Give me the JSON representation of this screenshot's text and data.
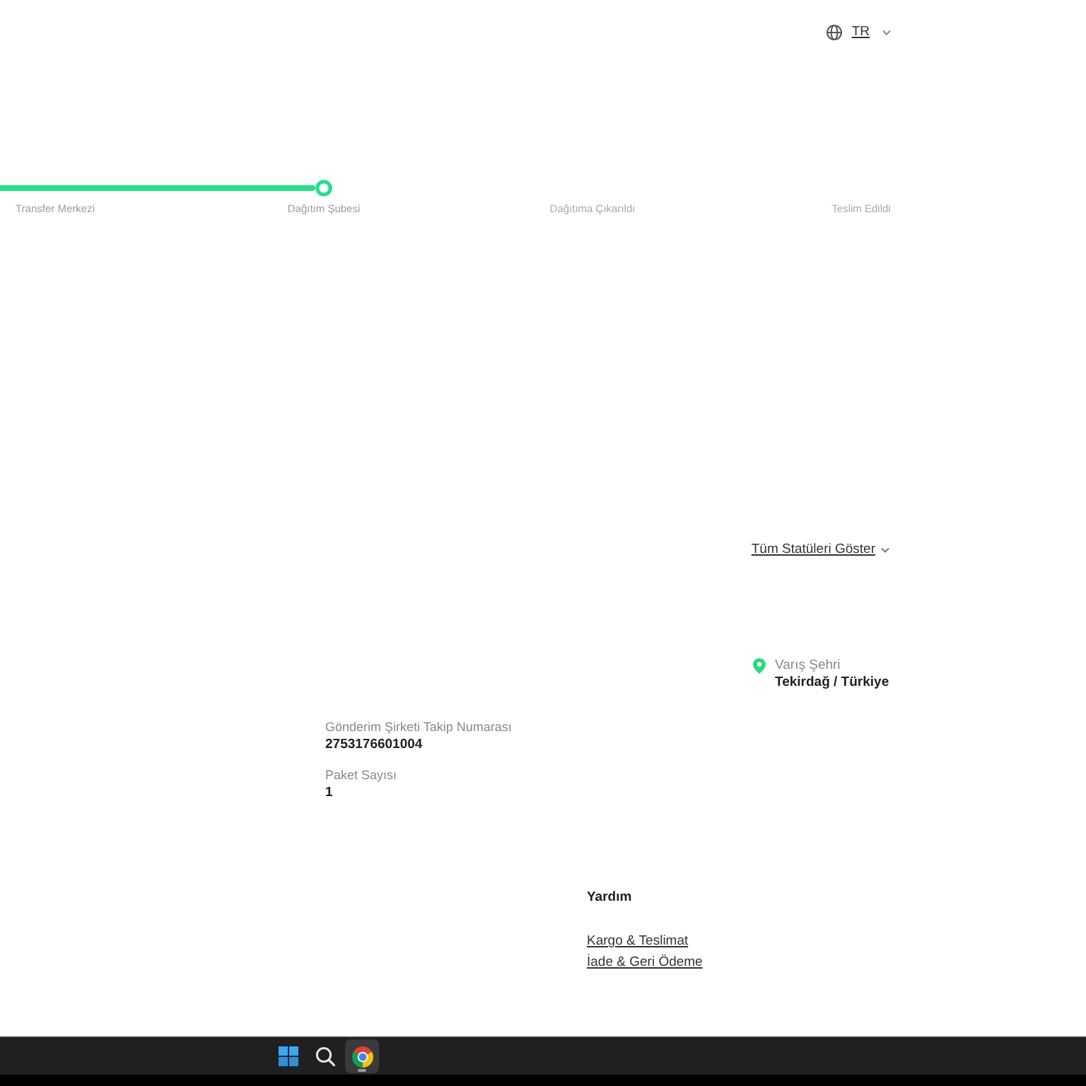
{
  "language_selector": {
    "code": "TR"
  },
  "progress_steps": [
    {
      "label": "Transfer Merkezi",
      "reached": true,
      "current": false
    },
    {
      "label": "Dağıtım Şubesi",
      "reached": true,
      "current": true
    },
    {
      "label": "Dağıtıma Çıkarıldı",
      "reached": false,
      "current": false
    },
    {
      "label": "Teslim Edildi",
      "reached": false,
      "current": false
    }
  ],
  "show_all_statuses": {
    "label": "Tüm Statüleri Göster"
  },
  "destination": {
    "label": "Varış Şehri",
    "value": "Tekirdağ / Türkiye"
  },
  "shipment_details": [
    {
      "label": "Gönderim Şirketi Takip Numarası",
      "value": "2753176601004"
    },
    {
      "label": "Paket Sayısı",
      "value": "1"
    }
  ],
  "help": {
    "title": "Yardım",
    "links": [
      "Kargo & Teslimat",
      "İade & Geri Ödeme"
    ]
  },
  "taskbar": {
    "apps": [
      {
        "kind": "start",
        "active": false
      },
      {
        "kind": "search",
        "active": false
      },
      {
        "kind": "browser",
        "active": true
      }
    ]
  }
}
